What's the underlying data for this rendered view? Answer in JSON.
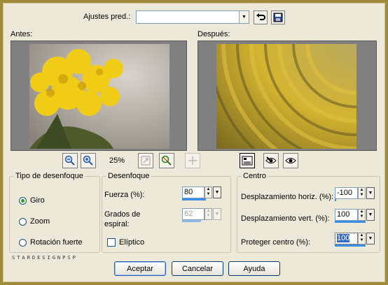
{
  "preset": {
    "label": "Ajustes pred.:",
    "value": ""
  },
  "previews": {
    "before_label": "Antes:",
    "after_label": "Después:"
  },
  "zoom": {
    "level": "25%"
  },
  "blur_type": {
    "title": "Tipo de desenfoque",
    "options": [
      {
        "label": "Giro",
        "selected": true
      },
      {
        "label": "Zoom",
        "selected": false
      },
      {
        "label": "Rotación fuerte",
        "selected": false
      }
    ]
  },
  "blur": {
    "title": "Desenfoque",
    "strength_label": "Fuerza (%):",
    "strength_value": "80",
    "strength_fill": 0.8,
    "spiral_label": "Grados de espiral:",
    "spiral_value": "62",
    "spiral_fill": 0.62,
    "elliptical_label": "Elíptico",
    "elliptical_checked": false
  },
  "center": {
    "title": "Centro",
    "h_label": "Desplazamiento horiz. (%):",
    "h_value": "-100",
    "h_fill": 0.0,
    "v_label": "Desplazamiento vert. (%):",
    "v_value": "100",
    "v_fill": 1.0,
    "protect_label": "Proteger centro (%):",
    "protect_value": "100",
    "protect_fill": 1.0
  },
  "watermark": "STARDESIGNPSP",
  "buttons": {
    "ok": "Aceptar",
    "cancel": "Cancelar",
    "help": "Ayuda"
  },
  "colors": {
    "frame": "#a08a3c",
    "dialog": "#ece9d8",
    "accent": "#3a8ee6"
  }
}
